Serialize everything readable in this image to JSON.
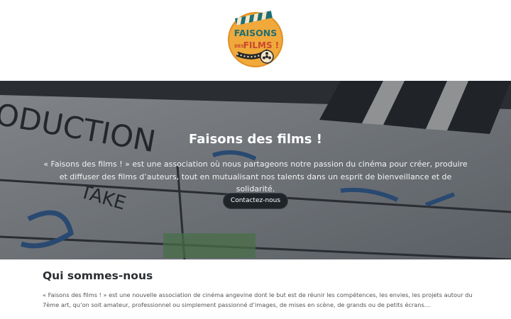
{
  "logo": {
    "line1": "FAISONS",
    "line2": "DES",
    "line3": "FILMS !"
  },
  "hero": {
    "title": "Faisons des films !",
    "text": "« Faisons des films ! » est une association où nous partageons notre passion du cinéma pour créer, produire et diffuser des films d’auteurs, tout en mutualisant nos talents dans un esprit de bienveillance et de solidarité.",
    "button_label": "Contactez-nous"
  },
  "about": {
    "title": "Qui sommes-nous",
    "text": "« Faisons des films ! » est une nouvelle association de cinéma angevine dont le but est de réunir les compétences, les envies, les projets autour du 7ème art, qu’on soit amateur, professionnel ou simplement passionné d’images, de mises en scène, de grands ou de petits écrans…"
  },
  "colors": {
    "logo_orange": "#f0a93a",
    "logo_teal": "#1f6e75",
    "logo_red": "#c8462e",
    "button_bg": "#1f2429"
  }
}
